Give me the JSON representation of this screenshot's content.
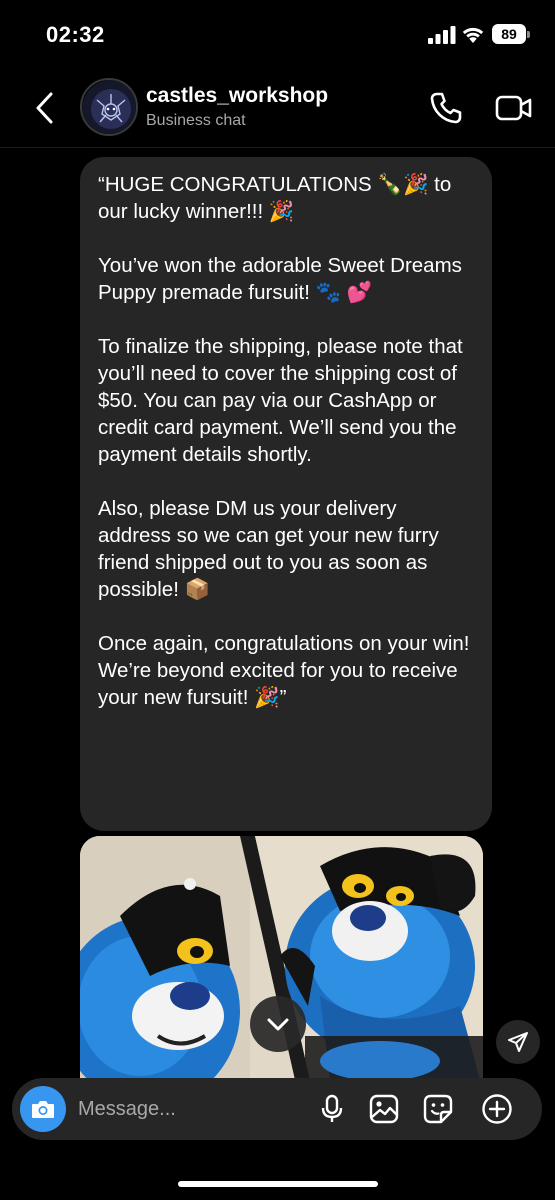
{
  "status_bar": {
    "time": "02:32",
    "battery": "89",
    "icons": [
      "signal-icon",
      "wifi-icon",
      "battery-icon"
    ]
  },
  "header": {
    "name": "castles_workshop",
    "subtitle": "Business chat",
    "icons": [
      "back-icon",
      "phone-icon",
      "video-icon"
    ]
  },
  "message": {
    "paragraphs": [
      "“HUGE CONGRATULATIONS 🍾🎉 to our lucky winner!!! 🎉",
      "You’ve won the adorable Sweet Dreams Puppy premade fursuit! 🐾 💕",
      "To finalize the shipping, please note that you’ll need to cover the shipping cost of $50. You can pay via our CashApp or credit card payment. We’ll send you the payment details shortly.",
      "Also, please DM us your delivery address so we can get your new furry friend shipped out to you as soon as possible! 📦",
      "Once again, congratulations on your win! We’re beyond excited for you to receive your new fursuit! 🎉”"
    ]
  },
  "composer": {
    "placeholder": "Message...",
    "icons": [
      "camera-icon",
      "microphone-icon",
      "gallery-icon",
      "sticker-icon",
      "add-icon"
    ]
  },
  "colors": {
    "background": "#000000",
    "bubble": "#262626",
    "accent": "#3797f0",
    "subtext": "#a8a8a8"
  }
}
